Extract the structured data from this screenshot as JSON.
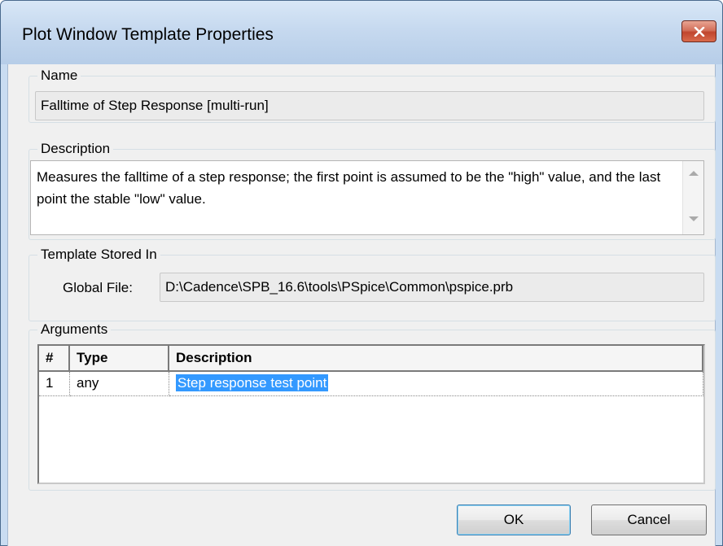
{
  "window": {
    "title": "Plot Window Template Properties",
    "close_icon": "close-icon"
  },
  "name_group": {
    "label": "Name",
    "value": "Falltime of Step Response [multi-run]"
  },
  "description_group": {
    "label": "Description",
    "text": "Measures the falltime of a step response; the first point is assumed to be the \"high\" value, and the last point the stable \"low\" value."
  },
  "template_group": {
    "label": "Template Stored In",
    "field_label": "Global File:",
    "path": "D:\\Cadence\\SPB_16.6\\tools\\PSpice\\Common\\pspice.prb"
  },
  "arguments_group": {
    "label": "Arguments",
    "columns": [
      "#",
      "Type",
      "Description"
    ],
    "rows": [
      {
        "num": "1",
        "type": "any",
        "description": "Step response test point",
        "selected": true
      }
    ]
  },
  "buttons": {
    "ok_label": "OK",
    "cancel_label": "Cancel"
  },
  "colors": {
    "selection": "#3399ff",
    "title_bar": "#c6d9ef",
    "close_button": "#c0452e"
  }
}
